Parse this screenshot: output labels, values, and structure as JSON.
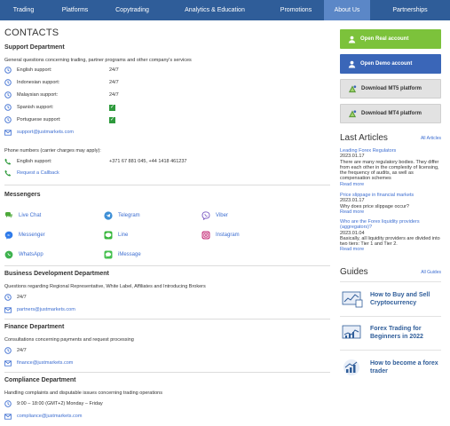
{
  "nav": [
    "Trading",
    "Platforms",
    "Copytrading",
    "Analytics & Education",
    "Promotions",
    "About Us",
    "Partnerships"
  ],
  "title": "CONTACTS",
  "support": {
    "heading": "Support Department",
    "desc": "General questions concerning trading, partner programs and other company's services",
    "items": [
      {
        "label": "English support:",
        "value": "24/7"
      },
      {
        "label": "Indonesian support:",
        "value": "24/7"
      },
      {
        "label": "Malaysian support:",
        "value": "24/7"
      },
      {
        "label": "Spanish support:",
        "value": "✓"
      },
      {
        "label": "Portuguese support:",
        "value": "✓"
      }
    ],
    "email": "support@justmarkets.com",
    "phones_desc": "Phone numbers (carrier charges may apply):",
    "phone_label": "English support:",
    "phone_value": "+371 67 881 045, +44 1418 461237",
    "callback": "Request a Callback"
  },
  "messengers": {
    "heading": "Messengers",
    "items": [
      "Live Chat",
      "Telegram",
      "Viber",
      "Messenger",
      "Line",
      "Instagram",
      "WhatsApp",
      "iMessage"
    ]
  },
  "bizdev": {
    "heading": "Business Development Department",
    "desc": "Questions regarding Regional Representative, White Label, Affiliates and Introducing Brokers",
    "hours": "24/7",
    "email": "partners@justmarkets.com"
  },
  "finance": {
    "heading": "Finance Department",
    "desc": "Consultations concerning payments and request processing",
    "hours": "24/7",
    "email": "finance@justmarkets.com"
  },
  "compliance": {
    "heading": "Compliance Department",
    "desc": "Handling complaints and disputable issues concerning trading operations",
    "hours": "9:00 – 18:00 (GMT+2) Monday – Friday",
    "email": "compliance@justmarkets.com"
  },
  "side": {
    "buttons": [
      "Open Real account",
      "Open Demo account",
      "Download MT5 platform",
      "Download MT4 platform"
    ],
    "articles_heading": "Last Articles",
    "all_articles": "All Articles",
    "articles": [
      {
        "title": "Leading Forex Regulators",
        "date": "2023.01.17",
        "text": "There are many regulatory bodies. They differ from each other in the complexity of licensing, the frequency of audits, as well as compensation schemes",
        "more": "Read more"
      },
      {
        "title": "Price slippage in financial markets",
        "date": "2023.01.17",
        "text": "Why does price slippage occur?",
        "more": "Read more"
      },
      {
        "title": "Who are the Forex liquidity providers (aggregators)?",
        "date": "2023.01.04",
        "text": "Basically, all liquidity providers are divided into two tiers: Tier 1 and Tier 2.",
        "more": "Read more"
      }
    ],
    "guides_heading": "Guides",
    "all_guides": "All Guides",
    "guides": [
      "How to Buy and Sell Cryptocurrency",
      "Forex Trading for Beginners in 2022",
      "How to become a forex trader"
    ]
  },
  "colors": {
    "nav": "#2f5d99",
    "nav_active": "#5b87c7",
    "link": "#3d6ed1",
    "green": "#7cc23b",
    "blue": "#3a66b8"
  }
}
